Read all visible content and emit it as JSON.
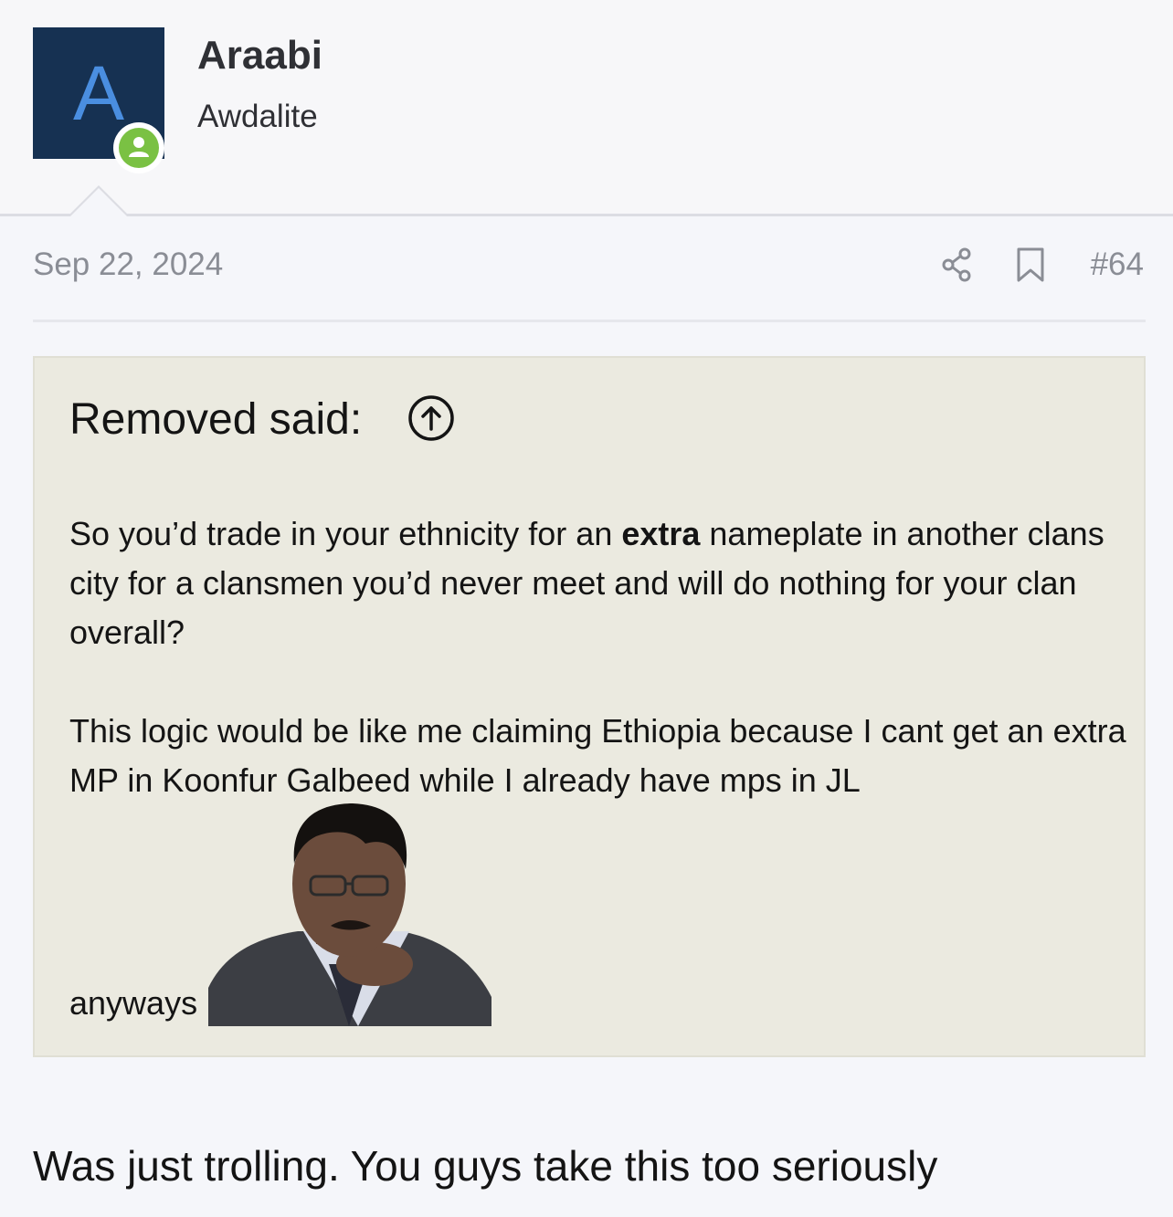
{
  "user": {
    "avatar_letter": "A",
    "name": "Araabi",
    "title": "Awdalite",
    "avatar_bg": "#163152",
    "avatar_letter_color": "#4a8ee0",
    "online_color": "#7ac143"
  },
  "post": {
    "date": "Sep 22, 2024",
    "number": "#64",
    "actions": [
      "share-icon",
      "bookmark-icon"
    ]
  },
  "quote": {
    "title": "Removed said:",
    "p1_before": "So you’d trade in your ethnicity for an ",
    "p1_bold": "extra",
    "p1_after": " nameplate in another clans city for a clansmen you’d never meet and will do nothing for your clan overall?",
    "p2": "This logic would be like me claiming Ethiopia because I cant get an extra MP in Koonfur Galbeed while I already have mps in JL",
    "tail": "anyways",
    "background": "#ebeae0"
  },
  "reply": {
    "text": "Was just trolling. You guys take this too seriously"
  }
}
